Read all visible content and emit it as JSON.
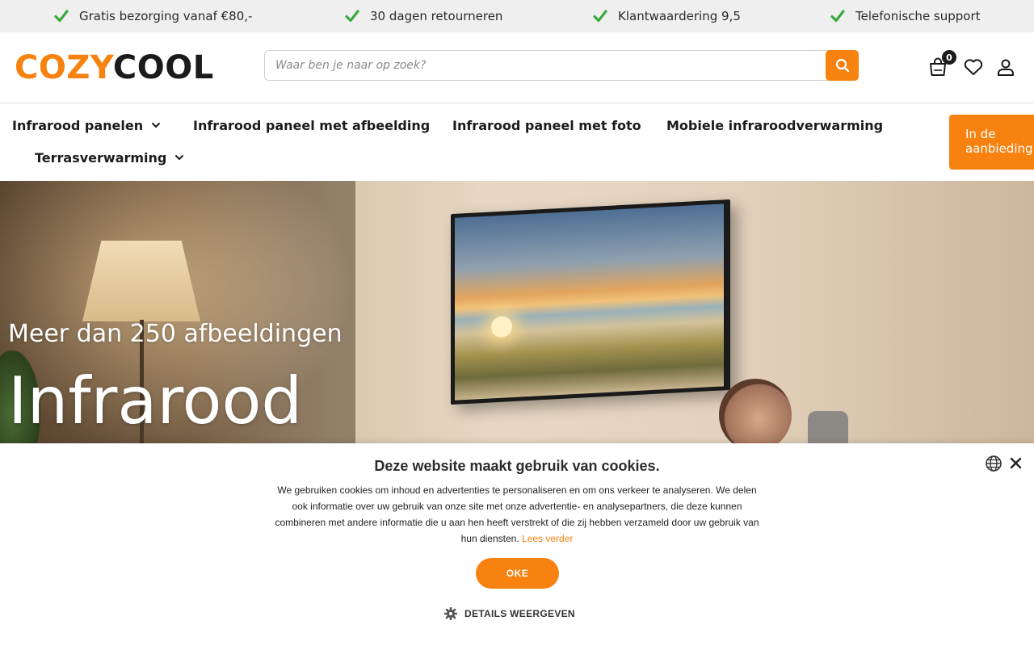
{
  "usp_bar": {
    "items": [
      "Gratis bezorging vanaf €80,-",
      "30 dagen retourneren",
      "Klantwaardering 9,5",
      "Telefonische support"
    ]
  },
  "header": {
    "logo_part1": "COZY",
    "logo_part2": "COOL",
    "search_placeholder": "Waar ben je naar op zoek?",
    "cart_count": "0"
  },
  "nav": {
    "items": [
      "Infrarood panelen",
      "Infrarood paneel met afbeelding",
      "Infrarood paneel met foto",
      "Mobiele infraroodverwarming",
      "Terrasverwarming"
    ],
    "promo_label": "In de aanbieding"
  },
  "hero": {
    "subtitle": "Meer dan 250 afbeeldingen",
    "title": "Infrarood"
  },
  "cookie": {
    "title": "Deze website maakt gebruik van cookies.",
    "text": "We gebruiken cookies om inhoud en advertenties te personaliseren en om ons verkeer te analyseren. We delen ook informatie over uw gebruik van onze site met onze advertentie- en analysepartners, die deze kunnen combineren met andere informatie die u aan hen heeft verstrekt of die zij hebben verzameld door uw gebruik van hun diensten.",
    "link": "Lees verder",
    "ok_label": "OKE",
    "details_label": "DETAILS WEERGEVEN"
  },
  "colors": {
    "accent": "#f7820f",
    "check": "#3aa93f",
    "dark": "#1b1b1b"
  },
  "icons": [
    "check-icon",
    "search-icon",
    "cart-icon",
    "heart-icon",
    "user-icon",
    "chevron-down-icon",
    "globe-icon",
    "close-icon",
    "gear-icon"
  ]
}
